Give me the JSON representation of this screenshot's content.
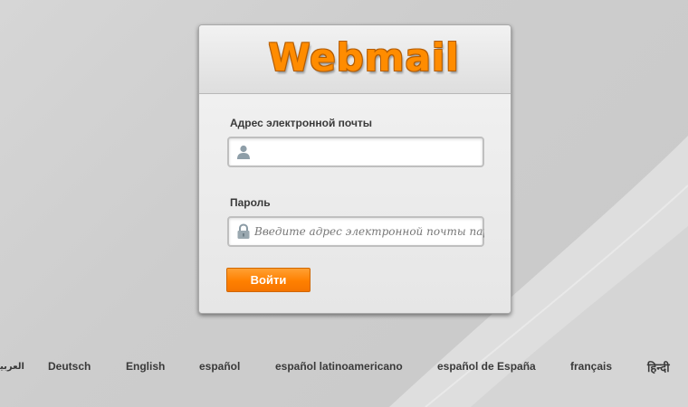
{
  "header": {
    "logo_text": "Webmail"
  },
  "form": {
    "email_label": "Адрес электронной почты",
    "email_value": "",
    "email_placeholder": "",
    "email_icon": "user-icon",
    "password_label": "Пароль",
    "password_value": "",
    "password_placeholder": "Введите адрес электронной почты пароль",
    "password_icon": "lock-icon",
    "submit_label": "Войти"
  },
  "languages": [
    {
      "label": "العربية"
    },
    {
      "label": "Deutsch"
    },
    {
      "label": "English"
    },
    {
      "label": "español"
    },
    {
      "label": "español latinoamericano"
    },
    {
      "label": "español de España"
    },
    {
      "label": "français"
    },
    {
      "label": "हिन्दी"
    }
  ],
  "colors": {
    "accent": "#ff8000",
    "logo": "#ff8c00",
    "background": "#cfcfcf",
    "text": "#3a3a3a"
  }
}
